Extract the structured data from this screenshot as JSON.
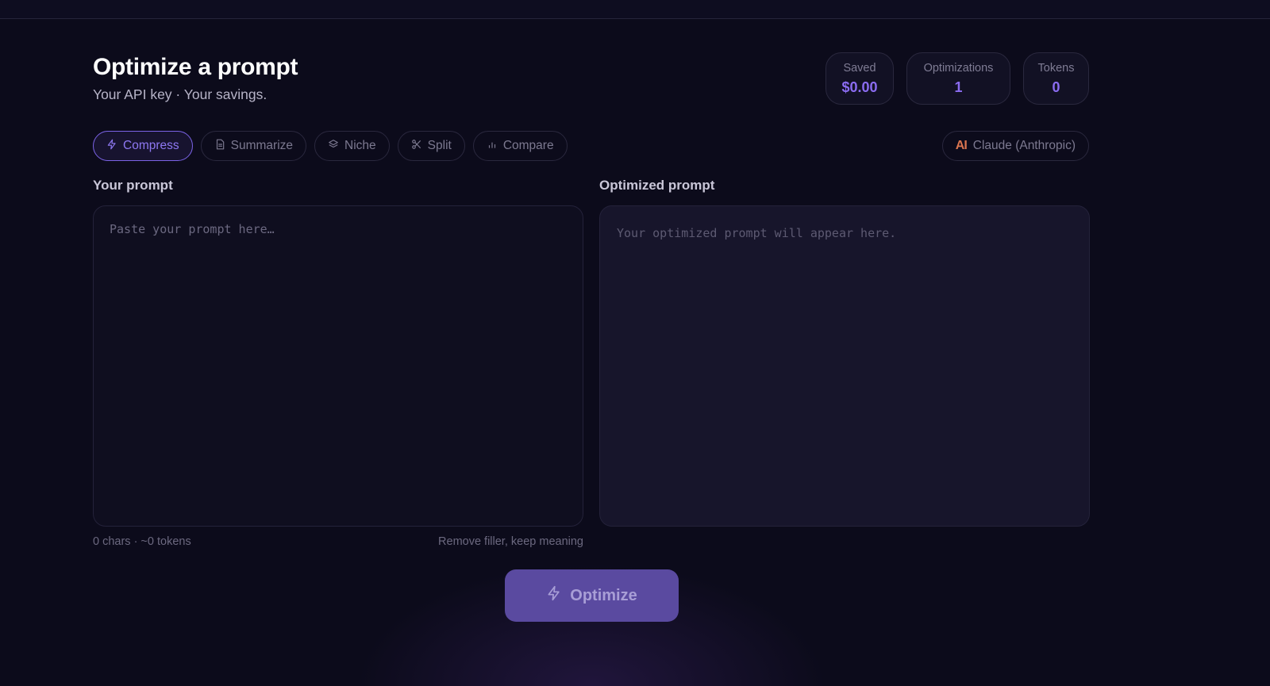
{
  "header": {
    "title": "Optimize a prompt",
    "subtitle": "Your API key · Your savings."
  },
  "stats": {
    "saved_label": "Saved",
    "saved_value": "$0.00",
    "optimizations_label": "Optimizations",
    "optimizations_value": "1",
    "tokens_label": "Tokens",
    "tokens_value": "0"
  },
  "tabs": [
    {
      "label": "Compress",
      "icon": "bolt-icon",
      "active": true
    },
    {
      "label": "Summarize",
      "icon": "document-icon",
      "active": false
    },
    {
      "label": "Niche",
      "icon": "layers-icon",
      "active": false
    },
    {
      "label": "Split",
      "icon": "scissors-icon",
      "active": false
    },
    {
      "label": "Compare",
      "icon": "bar-chart-icon",
      "active": false
    }
  ],
  "model": {
    "logo": "AI",
    "label": "Claude (Anthropic)"
  },
  "input": {
    "label": "Your prompt",
    "placeholder": "Paste your prompt here…",
    "value": "",
    "counter": "0 chars · ~0 tokens",
    "hint": "Remove filler, keep meaning"
  },
  "output": {
    "label": "Optimized prompt",
    "placeholder": "Your optimized prompt will appear here."
  },
  "action": {
    "optimize_label": "Optimize"
  },
  "colors": {
    "background": "#0c0b1b",
    "accent": "#8b6cf1",
    "button": "#5a4aa0",
    "anthropic_logo": "#d9744f"
  }
}
